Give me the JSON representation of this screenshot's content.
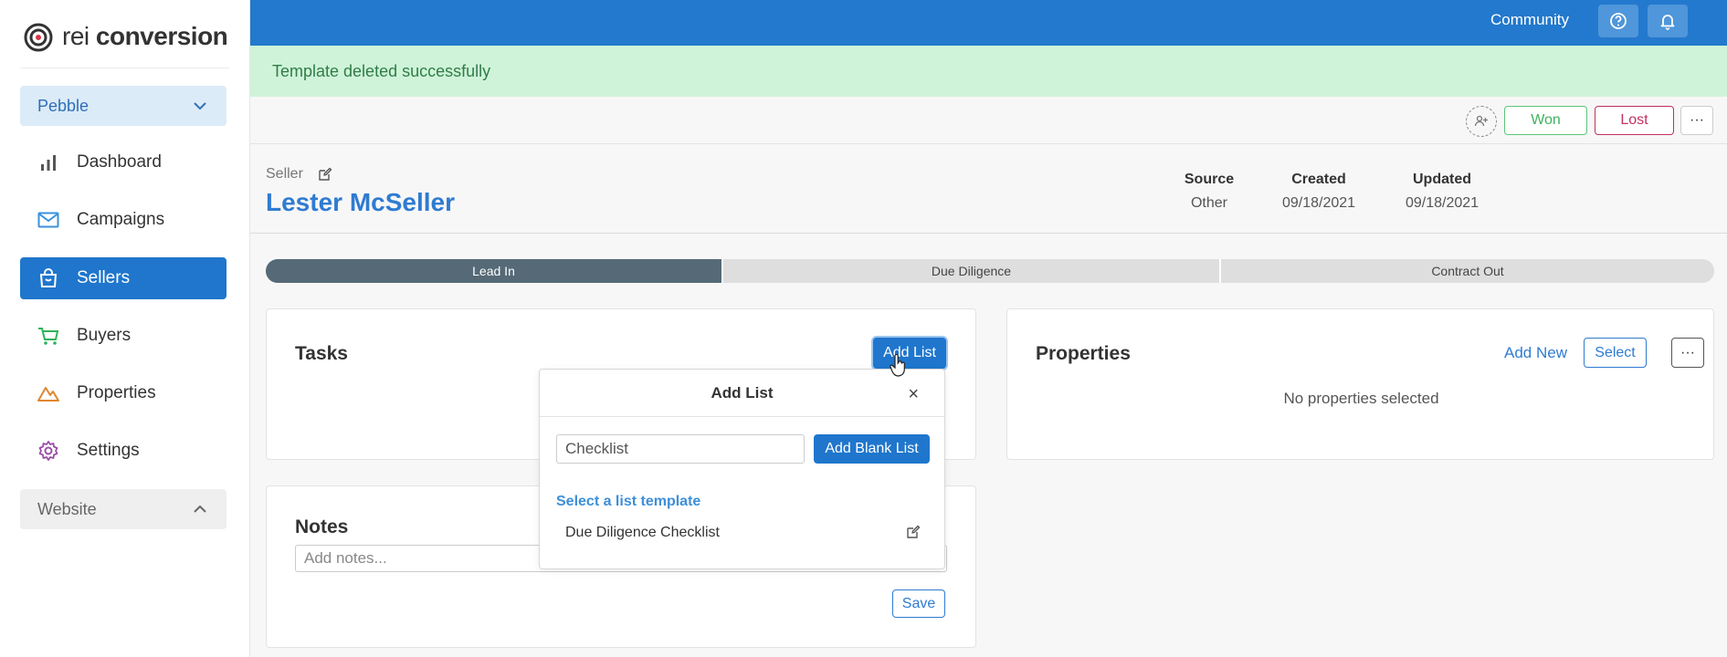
{
  "app": {
    "logo_light": "rei ",
    "logo_bold": "conversion"
  },
  "sidebar": {
    "account_select": "Pebble",
    "items": [
      {
        "label": "Dashboard",
        "icon": "bar-chart-icon"
      },
      {
        "label": "Campaigns",
        "icon": "mail-icon"
      },
      {
        "label": "Sellers",
        "icon": "basket-icon",
        "active": true
      },
      {
        "label": "Buyers",
        "icon": "cart-icon"
      },
      {
        "label": "Properties",
        "icon": "mountain-icon"
      },
      {
        "label": "Settings",
        "icon": "gear-icon"
      }
    ],
    "website_section": "Website"
  },
  "topbar": {
    "community": "Community"
  },
  "alert": {
    "message": "Template deleted successfully"
  },
  "actions": {
    "won": "Won",
    "lost": "Lost",
    "more": "···"
  },
  "record": {
    "type": "Seller",
    "name": "Lester McSeller",
    "meta": [
      {
        "label": "Source",
        "value": "Other"
      },
      {
        "label": "Created",
        "value": "09/18/2021"
      },
      {
        "label": "Updated",
        "value": "09/18/2021"
      }
    ]
  },
  "pipeline": {
    "stages": [
      "Lead In",
      "Due Diligence",
      "Contract Out"
    ],
    "active_index": 0
  },
  "tasks": {
    "title": "Tasks",
    "add_list": "Add List"
  },
  "add_list_popover": {
    "title": "Add List",
    "close": "×",
    "input_value": "Checklist",
    "add_blank": "Add Blank List",
    "template_heading": "Select a list template",
    "templates": [
      "Due Diligence Checklist"
    ]
  },
  "properties": {
    "title": "Properties",
    "add_new": "Add New",
    "select": "Select",
    "more": "···",
    "empty": "No properties selected"
  },
  "notes": {
    "title": "Notes",
    "placeholder": "Add notes...",
    "save": "Save"
  },
  "colors": {
    "brand": "#2379cd",
    "active_nav": "#1f76cc",
    "success_bg": "#cff3d9",
    "won": "#3db35f",
    "lost": "#c0305e",
    "stage_active": "#556a76"
  }
}
